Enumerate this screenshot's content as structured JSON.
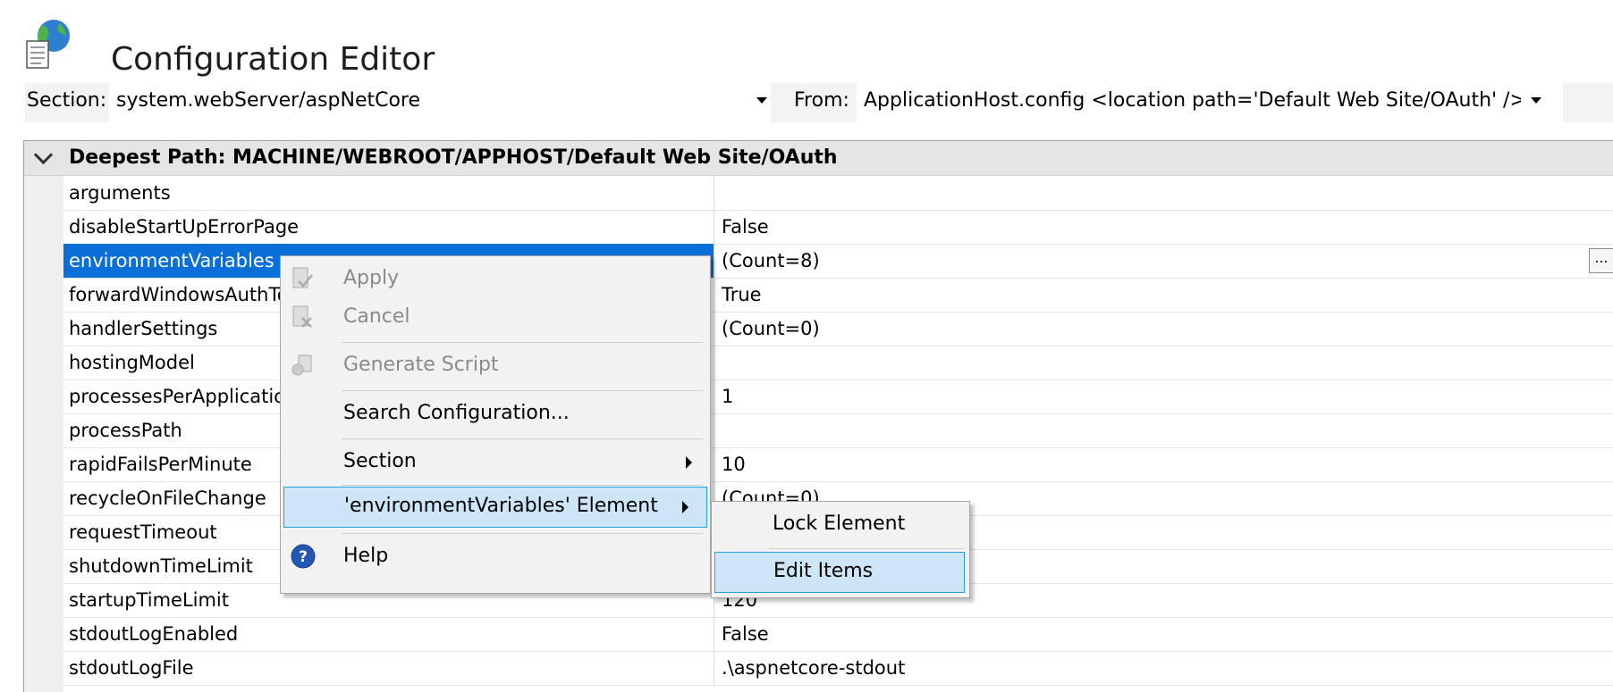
{
  "header": {
    "title": "Configuration Editor",
    "icon": "globe-config-icon"
  },
  "toolbar": {
    "section_label": "Section:",
    "section_value": "system.webServer/aspNetCore",
    "from_label": "From:",
    "from_value": "ApplicationHost.config <location path='Default Web Site/OAuth' />"
  },
  "grid": {
    "header": "Deepest Path: MACHINE/WEBROOT/APPHOST/Default Web Site/OAuth",
    "rows": [
      {
        "name": "arguments",
        "value": ""
      },
      {
        "name": "disableStartUpErrorPage",
        "value": "False"
      },
      {
        "name": "environmentVariables",
        "value": "(Count=8)"
      },
      {
        "name": "forwardWindowsAuthToken",
        "value": "True"
      },
      {
        "name": "handlerSettings",
        "value": "(Count=0)"
      },
      {
        "name": "hostingModel",
        "value": ""
      },
      {
        "name": "processesPerApplication",
        "value": "1"
      },
      {
        "name": "processPath",
        "value": ""
      },
      {
        "name": "rapidFailsPerMinute",
        "value": "10"
      },
      {
        "name": "recycleOnFileChange",
        "value": "(Count=0)"
      },
      {
        "name": "requestTimeout",
        "value": ""
      },
      {
        "name": "shutdownTimeLimit",
        "value": ""
      },
      {
        "name": "startupTimeLimit",
        "value": "120"
      },
      {
        "name": "stdoutLogEnabled",
        "value": "False"
      },
      {
        "name": "stdoutLogFile",
        "value": ".\\aspnetcore-stdout"
      }
    ],
    "ellipsis": "..."
  },
  "context_menu": {
    "items": [
      {
        "label": "Apply",
        "enabled": false,
        "icon": "apply-icon"
      },
      {
        "label": "Cancel",
        "enabled": false,
        "icon": "cancel-icon"
      },
      {
        "label": "Generate Script",
        "enabled": false,
        "icon": "script-icon"
      },
      {
        "label": "Search Configuration...",
        "enabled": true
      },
      {
        "label": "Section",
        "enabled": true,
        "submenu": true
      },
      {
        "label": "'environmentVariables' Element",
        "enabled": true,
        "submenu": true,
        "highlighted": true
      },
      {
        "label": "Help",
        "enabled": true,
        "icon": "help-icon"
      }
    ]
  },
  "sub_menu": {
    "items": [
      {
        "label": "Lock Element"
      },
      {
        "label": "Edit Items",
        "highlighted": true
      }
    ]
  },
  "colors": {
    "selection": "#0a6fd8",
    "menu_highlight": "#cde6f7",
    "menu_border": "#26a0da"
  }
}
